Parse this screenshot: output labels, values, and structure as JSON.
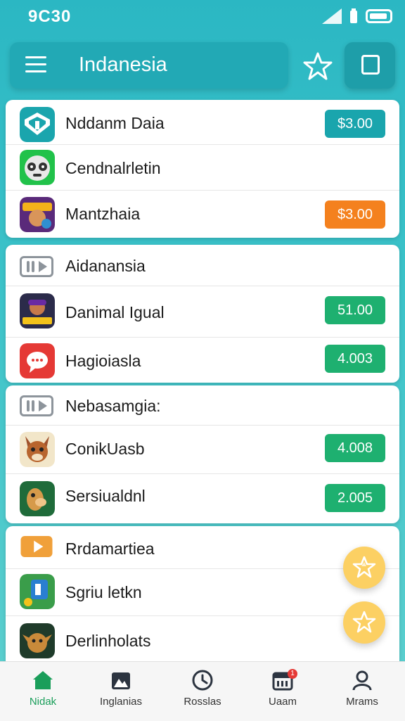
{
  "status": {
    "time": "9C30"
  },
  "appbar": {
    "title": "Indanesia"
  },
  "cards": [
    {
      "rows": [
        {
          "label": "Nddanm Daia",
          "price": "$3.00",
          "price_color": "#1aa5ad",
          "icon": "teal-shield-icon"
        },
        {
          "label": "Cendnalrletin",
          "price": "",
          "icon": "robot-face-icon"
        },
        {
          "label": "Mantzhaia",
          "price": "$3.00",
          "price_color": "#f4811e",
          "icon": "game-character-icon"
        }
      ]
    },
    {
      "header": {
        "label": "Aidanansia",
        "icon": "video-play-icon"
      },
      "rows": [
        {
          "label": "Danimal Igual",
          "price": "51.00",
          "price_color": "#1eb070",
          "icon": "hero-game-icon"
        },
        {
          "label": "Hagioiasla",
          "price": "4.003",
          "price_color": "#1eb070",
          "icon": "chat-bubble-icon"
        }
      ]
    },
    {
      "header": {
        "label": "Nebasamgia:",
        "icon": "video-play-icon"
      },
      "rows": [
        {
          "label": "ConikUasb",
          "price": "4.008",
          "price_color": "#1eb070",
          "icon": "fox-character-icon"
        },
        {
          "label": "Sersiualdnl",
          "price": "2.005",
          "price_color": "#1eb070",
          "icon": "alpaca-icon"
        }
      ]
    },
    {
      "header": {
        "label": "Rrdamartiea",
        "icon": "orange-play-icon"
      },
      "rows": [
        {
          "label": "Sgriu letkn",
          "price": "",
          "icon": "game-cube-icon"
        },
        {
          "label": "Derlinholats",
          "price": "",
          "icon": "goblin-icon"
        }
      ]
    }
  ],
  "fabs": [
    {
      "icon": "star-icon"
    },
    {
      "icon": "star-outline-icon"
    }
  ],
  "nav": [
    {
      "label": "Nidak",
      "icon": "home-icon",
      "active": true
    },
    {
      "label": "Inglanias",
      "icon": "mountain-icon"
    },
    {
      "label": "Rosslas",
      "icon": "clock-icon"
    },
    {
      "label": "Uaam",
      "icon": "calendar-icon",
      "badge": "1"
    },
    {
      "label": "Mrams",
      "icon": "person-icon"
    }
  ]
}
